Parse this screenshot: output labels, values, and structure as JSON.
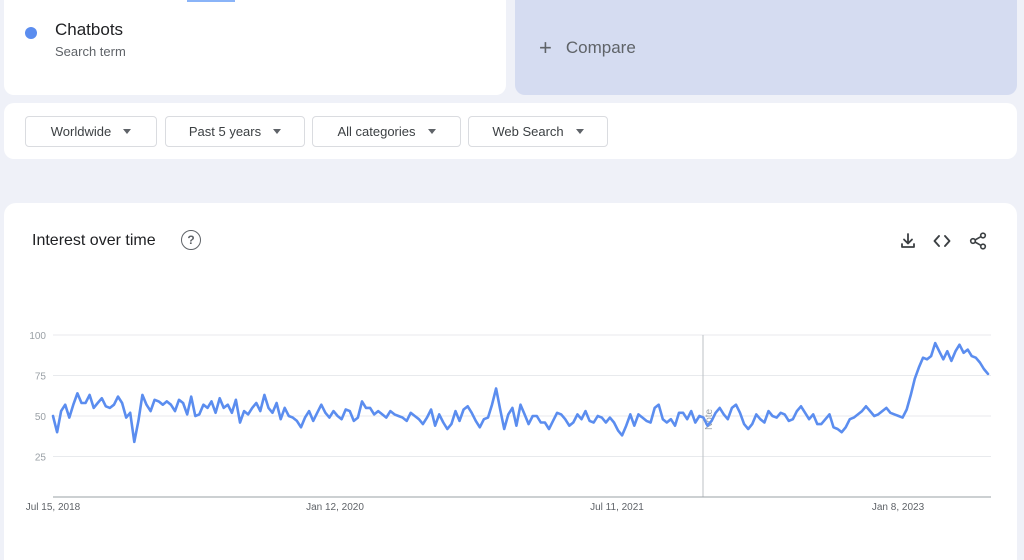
{
  "search_term": {
    "name": "Chatbots",
    "subtitle": "Search term",
    "color": "#5b8def"
  },
  "compare": {
    "label": "Compare",
    "icon": "plus-icon"
  },
  "filters": [
    {
      "label": "Worldwide",
      "icon": "caret-down-icon"
    },
    {
      "label": "Past 5 years",
      "icon": "caret-down-icon"
    },
    {
      "label": "All categories",
      "icon": "caret-down-icon"
    },
    {
      "label": "Web Search",
      "icon": "caret-down-icon"
    }
  ],
  "panel": {
    "title": "Interest over time",
    "help_icon": "help-circle-icon",
    "actions": [
      "download-icon",
      "embed-code-icon",
      "share-icon"
    ]
  },
  "chart_data": {
    "type": "line",
    "yticks": [
      100,
      75,
      50,
      25
    ],
    "ylim": [
      0,
      100
    ],
    "x_tick_labels": [
      "Jul 15, 2018",
      "Jan 12, 2020",
      "Jul 11, 2021",
      "Jan 8, 2023"
    ],
    "annotation": "Note",
    "grid": true,
    "series": [
      {
        "color": "#5b8def",
        "values": [
          50,
          40,
          53,
          57,
          49,
          57,
          64,
          58,
          58,
          63,
          55,
          58,
          61,
          56,
          55,
          57,
          62,
          58,
          49,
          52,
          34,
          47,
          63,
          57,
          53,
          60,
          59,
          57,
          59,
          57,
          53,
          60,
          58,
          51,
          62,
          50,
          51,
          57,
          55,
          59,
          52,
          61,
          55,
          57,
          52,
          60,
          46,
          53,
          51,
          55,
          58,
          53,
          63,
          55,
          52,
          58,
          48,
          55,
          50,
          49,
          47,
          43,
          49,
          53,
          47,
          52,
          57,
          52,
          49,
          53,
          50,
          48,
          54,
          53,
          47,
          49,
          59,
          55,
          55,
          51,
          53,
          51,
          49,
          53,
          51,
          50,
          49,
          47,
          52,
          50,
          48,
          45,
          49,
          54,
          44,
          51,
          46,
          42,
          45,
          53,
          47,
          54,
          56,
          52,
          47,
          43,
          48,
          49,
          57,
          67,
          54,
          42,
          51,
          55,
          44,
          57,
          51,
          45,
          50,
          50,
          46,
          46,
          42,
          47,
          52,
          51,
          48,
          44,
          46,
          51,
          48,
          53,
          47,
          46,
          50,
          49,
          46,
          49,
          46,
          41,
          38,
          44,
          51,
          44,
          51,
          49,
          47,
          46,
          55,
          57,
          48,
          46,
          48,
          44,
          52,
          52,
          48,
          53,
          46,
          50,
          49,
          44,
          47,
          52,
          55,
          51,
          48,
          55,
          57,
          52,
          45,
          42,
          45,
          51,
          48,
          46,
          53,
          50,
          49,
          52,
          51,
          47,
          48,
          53,
          56,
          52,
          48,
          51,
          45,
          45,
          48,
          51,
          43,
          42,
          40,
          43,
          48,
          49,
          51,
          53,
          56,
          53,
          50,
          51,
          53,
          55,
          52,
          51,
          50,
          49,
          54,
          63,
          73,
          80,
          86,
          85,
          87,
          95,
          90,
          85,
          90,
          84,
          90,
          94,
          89,
          91,
          87,
          86,
          83,
          79,
          76
        ]
      }
    ]
  }
}
